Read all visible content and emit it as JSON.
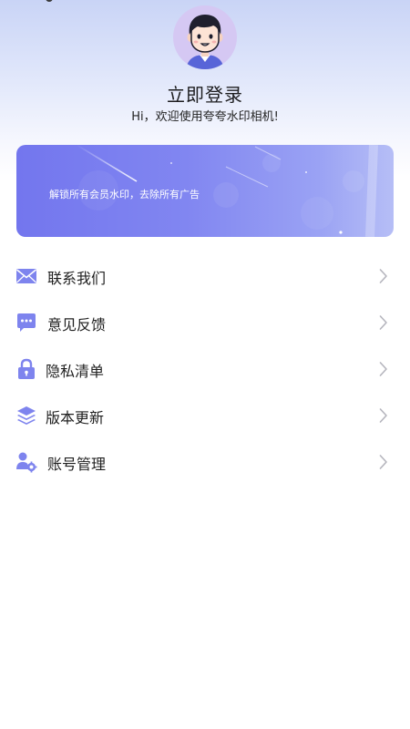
{
  "header": {
    "login_title": "立即登录",
    "welcome_text": "Hi，欢迎使用夸夸水印相机!"
  },
  "vip_banner": {
    "text": "解锁所有会员水印，去除所有广告"
  },
  "menu": {
    "items": [
      {
        "label": "联系我们",
        "icon": "envelope-icon"
      },
      {
        "label": "意见反馈",
        "icon": "feedback-chat-icon"
      },
      {
        "label": "隐私清单",
        "icon": "lock-icon"
      },
      {
        "label": "版本更新",
        "icon": "layers-icon"
      },
      {
        "label": "账号管理",
        "icon": "user-settings-icon"
      }
    ]
  },
  "colors": {
    "accent": "#7b7ff0",
    "banner_start": "#7376ee",
    "banner_end": "#b6bef6",
    "icon": "#8086f0",
    "chevron": "#b5b5bd"
  }
}
